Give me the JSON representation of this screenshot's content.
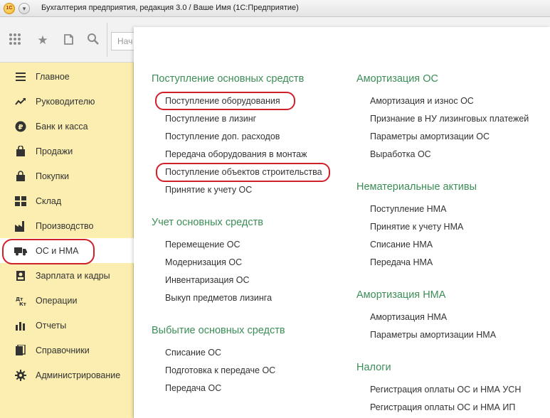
{
  "window": {
    "title": "Бухгалтерия предприятия, редакция 3.0 / Ваше Имя  (1С:Предприятие)",
    "logo_text": "1С",
    "menu_glyph": "▾"
  },
  "toolbar": {
    "search_placeholder": "Нач",
    "icons": [
      "apps-grid-icon",
      "star-icon",
      "history-icon",
      "search-icon"
    ]
  },
  "sidebar": {
    "items": [
      {
        "label": "Главное",
        "icon": "menu-lines-icon"
      },
      {
        "label": "Руководителю",
        "icon": "trend-icon"
      },
      {
        "label": "Банк и касса",
        "icon": "ruble-icon"
      },
      {
        "label": "Продажи",
        "icon": "bag-icon"
      },
      {
        "label": "Покупки",
        "icon": "basket-icon"
      },
      {
        "label": "Склад",
        "icon": "warehouse-icon"
      },
      {
        "label": "Производство",
        "icon": "factory-icon"
      },
      {
        "label": "ОС и НМА",
        "icon": "truck-icon",
        "active": true
      },
      {
        "label": "Зарплата и кадры",
        "icon": "person-icon"
      },
      {
        "label": "Операции",
        "icon": "dt-kt-icon"
      },
      {
        "label": "Отчеты",
        "icon": "bar-chart-icon"
      },
      {
        "label": "Справочники",
        "icon": "books-icon"
      },
      {
        "label": "Администрирование",
        "icon": "gear-icon"
      }
    ]
  },
  "left_column": [
    {
      "title": "Поступление основных средств",
      "items": [
        "Поступление оборудования",
        "Поступление в лизинг",
        "Поступление доп. расходов",
        "Передача оборудования в монтаж",
        "Поступление объектов строительства",
        "Принятие к учету ОС"
      ]
    },
    {
      "title": "Учет основных средств",
      "items": [
        "Перемещение ОС",
        "Модернизация ОС",
        "Инвентаризация ОС",
        "Выкуп предметов лизинга"
      ]
    },
    {
      "title": "Выбытие основных средств",
      "items": [
        "Списание ОС",
        "Подготовка к передаче ОС",
        "Передача ОС"
      ]
    }
  ],
  "right_column": [
    {
      "title": "Амортизация ОС",
      "items": [
        "Амортизация и износ ОС",
        "Признание в НУ лизинговых платежей",
        "Параметры амортизации ОС",
        "Выработка ОС"
      ]
    },
    {
      "title": "Нематериальные активы",
      "items": [
        "Поступление НМА",
        "Принятие к учету НМА",
        "Списание НМА",
        "Передача НМА"
      ]
    },
    {
      "title": "Амортизация НМА",
      "items": [
        "Амортизация НМА",
        "Параметры амортизации НМА"
      ]
    },
    {
      "title": "Налоги",
      "items": [
        "Регистрация оплаты ОС и НМА УСН",
        "Регистрация оплаты ОС и НМА ИП"
      ]
    }
  ],
  "colors": {
    "sidebar_bg": "#fbeeb0",
    "section_heading": "#3c8e57",
    "highlight_oval": "#d0202a"
  }
}
